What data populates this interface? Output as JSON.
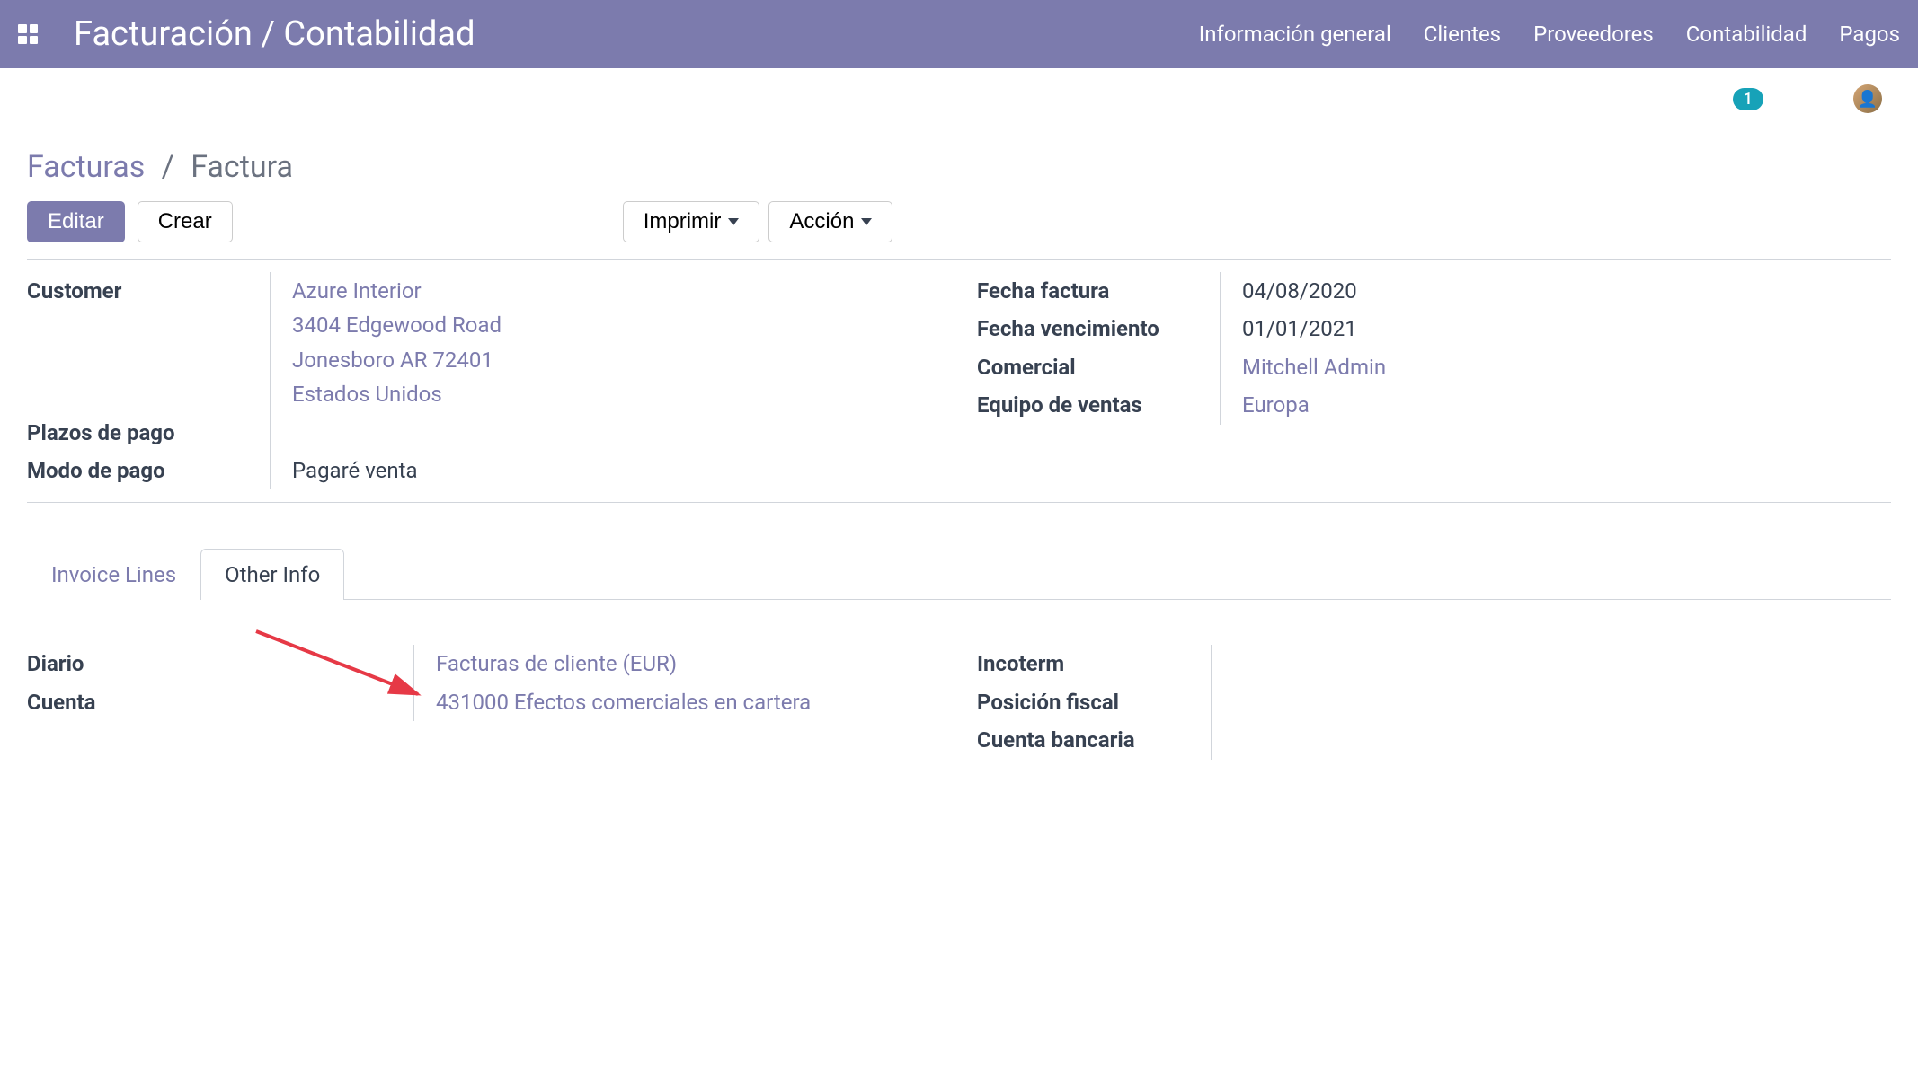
{
  "navbar": {
    "title": "Facturación / Contabilidad",
    "menu": [
      "Información general",
      "Clientes",
      "Proveedores",
      "Contabilidad",
      "Pagos"
    ]
  },
  "indicator": {
    "count": "1"
  },
  "breadcrumb": {
    "parent": "Facturas",
    "current": "Factura"
  },
  "toolbar": {
    "edit": "Editar",
    "create": "Crear",
    "print": "Imprimir",
    "action": "Acción"
  },
  "form": {
    "left": {
      "customer_label": "Customer",
      "customer_name": "Azure Interior",
      "customer_addr1": "3404 Edgewood Road",
      "customer_addr2": "Jonesboro AR 72401",
      "customer_addr3": "Estados Unidos",
      "pay_terms_label": "Plazos de pago",
      "pay_mode_label": "Modo de pago",
      "pay_mode_value": "Pagaré venta"
    },
    "right": {
      "invoice_date_label": "Fecha factura",
      "invoice_date_value": "04/08/2020",
      "due_date_label": "Fecha vencimiento",
      "due_date_value": "01/01/2021",
      "salesperson_label": "Comercial",
      "salesperson_value": "Mitchell Admin",
      "sales_team_label": "Equipo de ventas",
      "sales_team_value": "Europa"
    }
  },
  "tabs": {
    "invoice_lines": "Invoice Lines",
    "other_info": "Other Info"
  },
  "other_info": {
    "left": {
      "journal_label": "Diario",
      "journal_value": "Facturas de cliente (EUR)",
      "account_label": "Cuenta",
      "account_value": "431000 Efectos comerciales en cartera"
    },
    "right": {
      "incoterm_label": "Incoterm",
      "fiscal_label": "Posición fiscal",
      "bank_label": "Cuenta bancaria"
    }
  }
}
